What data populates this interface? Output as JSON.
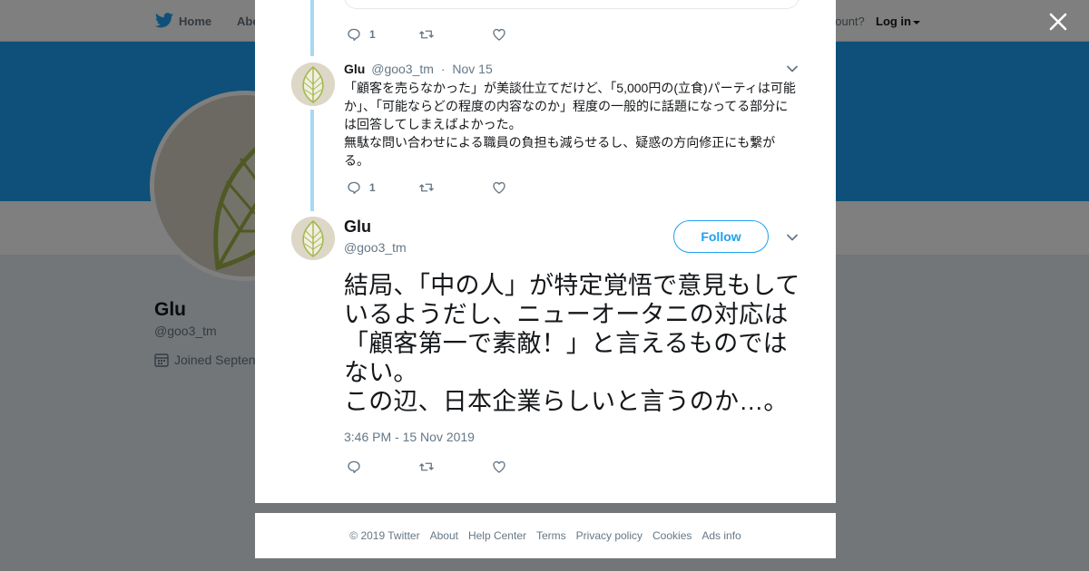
{
  "topbar": {
    "home_label": "Home",
    "about_label": "Abo",
    "account_prompt": "account?",
    "login_label": "Log in"
  },
  "profile": {
    "name": "Glu",
    "handle": "@goo3_tm",
    "joined": "Joined Septen"
  },
  "thread": {
    "prev_reply_count": "1",
    "reply": {
      "name": "Glu",
      "handle": "@goo3_tm",
      "separator": "·",
      "date": "Nov 15",
      "text": "「顧客を売らなかった」が美談仕立てだけど、「5,000円の(立食)パーティは可能か」、「可能ならどの程度の内容なのか」程度の一般的に話題になってる部分には回答してしまえばよかった。\n無駄な問い合わせによる職員の負担も減らせるし、疑惑の方向修正にも繋がる。",
      "reply_count": "1"
    },
    "main": {
      "name": "Glu",
      "handle": "@goo3_tm",
      "follow_label": "Follow",
      "text": "結局、「中の人」が特定覚悟で意見もしているようだし、ニューオータニの対応は「顧客第一で素敵！」と言えるものではない。\nこの辺、日本企業らしいと言うのか…。",
      "timestamp": "3:46 PM - 15 Nov 2019"
    }
  },
  "footer": {
    "links": [
      "© 2019 Twitter",
      "About",
      "Help Center",
      "Terms",
      "Privacy policy",
      "Cookies",
      "Ads info"
    ]
  },
  "colors": {
    "brand": "#1da1f2",
    "thread_line": "#a8d7f6",
    "muted": "#657786"
  }
}
